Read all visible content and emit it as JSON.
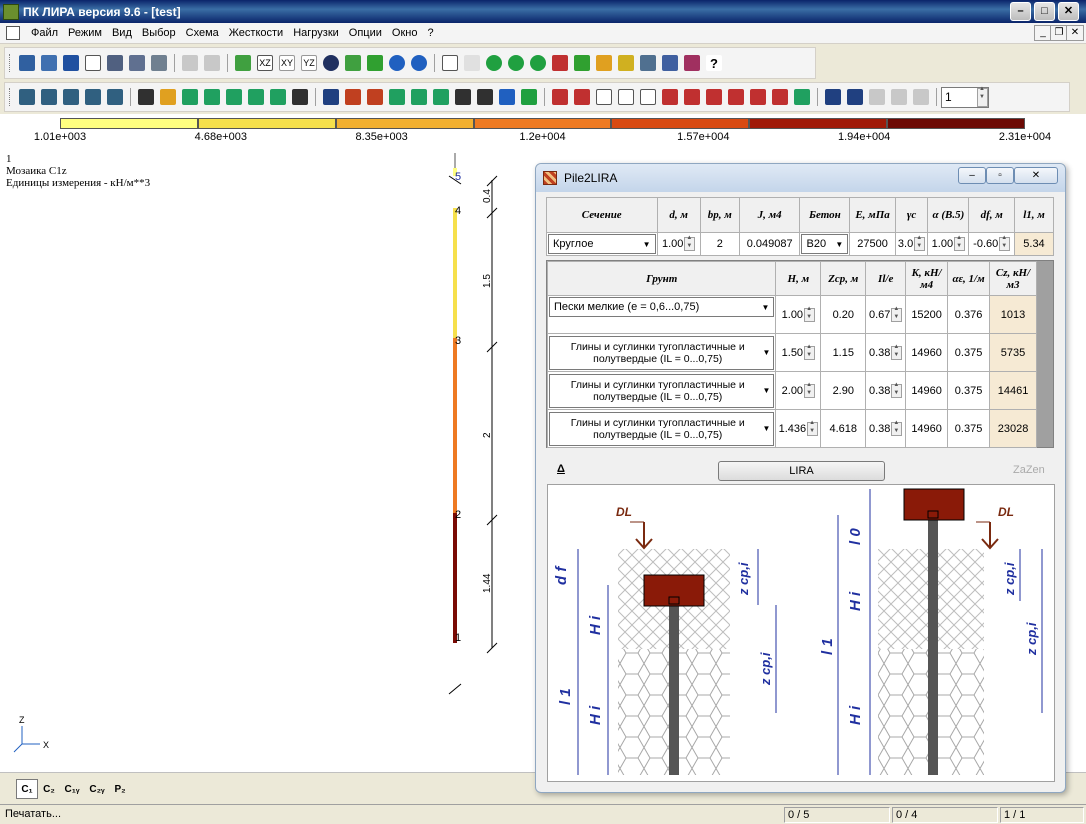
{
  "app": {
    "title": "ПК ЛИРА версия 9.6 - [test]",
    "menu": [
      "Файл",
      "Режим",
      "Вид",
      "Выбор",
      "Схема",
      "Жесткости",
      "Нагрузки",
      "Опции",
      "Окно",
      "?"
    ]
  },
  "toolbar": {
    "spin_value": "1"
  },
  "scale": {
    "labels": [
      "1.01e+003",
      "4.68e+003",
      "8.35e+003",
      "1.2e+004",
      "1.57e+004",
      "1.94e+004",
      "2.31e+004"
    ],
    "colors": [
      "#ffff80",
      "#f6e04c",
      "#f2b030",
      "#ee7a22",
      "#d84a12",
      "#a01a08",
      "#6c0a04"
    ]
  },
  "workspace": {
    "info": [
      "1",
      "Мозаика C1z",
      "Единицы измерения - кН/м**3"
    ],
    "node_labels": [
      "5",
      "4",
      "3",
      "2",
      "1"
    ],
    "dim_labels": [
      "0.4",
      "1.5",
      "2",
      "1.44"
    ],
    "axis": {
      "z": "Z",
      "x": "X"
    }
  },
  "tabs": [
    "C₁",
    "C₂",
    "C₁ᵧ",
    "C₂ᵧ",
    "P₂"
  ],
  "status": {
    "text": "Печатать...",
    "cell1": "0 / 5",
    "cell2": "0 / 4",
    "cell3": "1 / 1"
  },
  "dialog": {
    "title": "Pile2LIRA",
    "section_headers": [
      "Сечение",
      "d, м",
      "bp, м",
      "J, м4",
      "Бетон",
      "E, мПа",
      "γc",
      "α (B.5)",
      "df, м",
      "l1, м"
    ],
    "section_row": {
      "section": "Круглое",
      "d": "1.00",
      "bp": "2",
      "J": "0.049087",
      "concrete": "B20",
      "E": "27500",
      "gamma": "3.0",
      "alpha": "1.00",
      "df": "-0.60",
      "l1": "5.34"
    },
    "soil_headers": [
      "Грунт",
      "H, м",
      "Zср, м",
      "Il/e",
      "K, кН/м4",
      "αε, 1/м",
      "Cz, кН/м3"
    ],
    "soil_rows": [
      {
        "soil": "Пески мелкие (е = 0,6...0,75)",
        "H": "1.00",
        "Zcp": "0.20",
        "Il": "0.67",
        "K": "15200",
        "alpha": "0.376",
        "Cz": "1013"
      },
      {
        "soil": "Глины и суглинки тугопластичные и полутвердые (IL = 0...0,75)",
        "H": "1.50",
        "Zcp": "1.15",
        "Il": "0.38",
        "K": "14960",
        "alpha": "0.375",
        "Cz": "5735"
      },
      {
        "soil": "Глины и суглинки тугопластичные и полутвердые (IL = 0...0,75)",
        "H": "2.00",
        "Zcp": "2.90",
        "Il": "0.38",
        "K": "14960",
        "alpha": "0.375",
        "Cz": "14461"
      },
      {
        "soil": "Глины и суглинки тугопластичные и полутвердые (IL = 0...0,75)",
        "H": "1.436",
        "Zcp": "4.618",
        "Il": "0.38",
        "K": "14960",
        "alpha": "0.375",
        "Cz": "23028"
      }
    ],
    "lira_button": "LIRA",
    "collapse_symbol": "Δ",
    "zazen": "ZaZen",
    "scheme_labels": {
      "load": "DL",
      "df": "d f",
      "Hi": "H i",
      "l1": "l 1",
      "l0": "l 0",
      "zcp": "z ср,i"
    }
  }
}
